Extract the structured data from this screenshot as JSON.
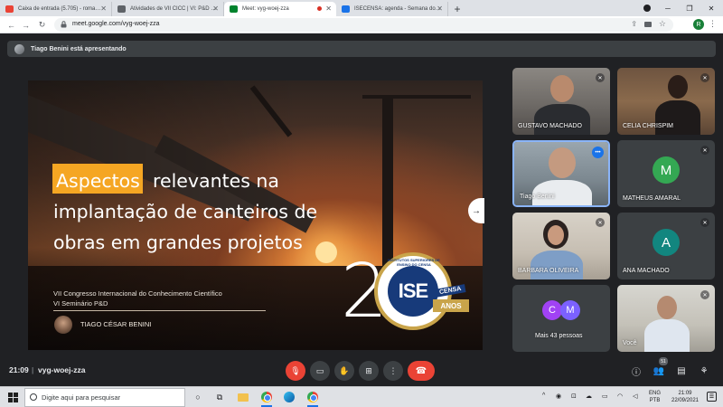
{
  "browser": {
    "tabs": [
      {
        "label": "Caixa de entrada (5.705) - roma…",
        "favicon_color": "#ea4335"
      },
      {
        "label": "Atividades de VII CICC | VI: P&D …",
        "favicon_color": "#5f6368"
      },
      {
        "label": "Meet: vyg-woej-zza",
        "favicon_color": "#00832d"
      },
      {
        "label": "ISECENSA: agenda - Semana do…",
        "favicon_color": "#1a73e8"
      }
    ],
    "new_tab": "+",
    "url": "meet.google.com/vyg-woej-zza",
    "profile_initial": "R"
  },
  "meet": {
    "presenting_banner": "Tiago Benini está apresentando",
    "slide": {
      "title_highlight": "Aspectos",
      "title_rest": "relevantes na implantação de canteiros de obras em grandes projetos",
      "conference_line1": "VII Congresso Internacional do Conhecimento Científico",
      "conference_line2": "VI Seminário P&D",
      "author": "TIAGO CÉSAR BENINI",
      "logo_digit_left": "2",
      "logo_digit_right": "0",
      "logo_seal_text": "ISE",
      "logo_seal_ring": "INSTITUTOS SUPERIORES DE ENSINO DO CENSA",
      "logo_censa": "CENSA",
      "logo_anos": "ANOS"
    },
    "participants": [
      {
        "name": "GUSTAVO MACHADO",
        "muted": true
      },
      {
        "name": "CELIA CHRISPIM",
        "muted": true
      },
      {
        "name": "Tiago Benini",
        "muted": false,
        "active": true
      },
      {
        "name": "MATHEUS AMARAL",
        "muted": true,
        "initial": "M",
        "color": "#34a853"
      },
      {
        "name": "BARBARA OLIVEIRA",
        "muted": true
      },
      {
        "name": "ANA MACHADO",
        "muted": true,
        "initial": "A",
        "color": "#12867f"
      },
      {
        "name": "Mais 43 pessoas",
        "initials": [
          "C",
          "M"
        ],
        "colors": [
          "#a142f4",
          "#7b61ff"
        ]
      },
      {
        "name": "Você",
        "muted": true
      }
    ],
    "controls": {
      "time": "21:09",
      "separator": "|",
      "meeting_code": "vyg-woej-zza",
      "participant_count": "51"
    }
  },
  "taskbar": {
    "search_placeholder": "Digite aqui para pesquisar",
    "lang_line1": "ENG",
    "lang_line2": "PTB",
    "clock_time": "21:09",
    "clock_date": "22/09/2021"
  }
}
